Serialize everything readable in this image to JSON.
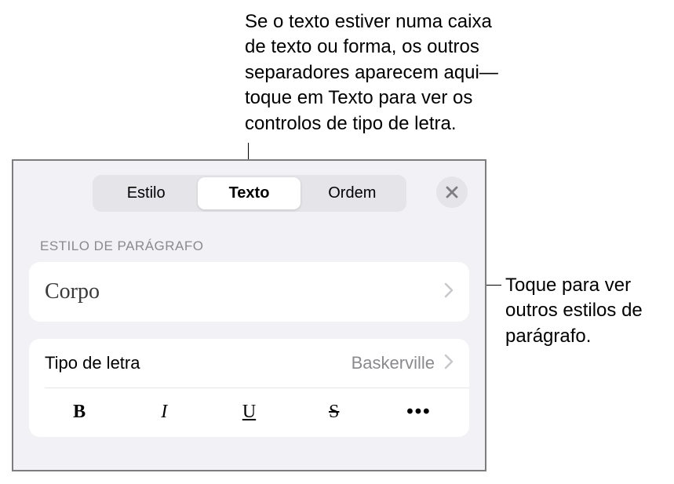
{
  "annotations": {
    "top": "Se o texto estiver numa caixa de texto ou forma, os outros separadores aparecem aqui—toque em Texto para ver os controlos de tipo de letra.",
    "right": "Toque para ver outros estilos de parágrafo."
  },
  "tabs": {
    "style": "Estilo",
    "text": "Texto",
    "order": "Ordem"
  },
  "section": {
    "paragraph_style_label": "ESTILO DE PARÁGRAFO"
  },
  "paragraph_style": {
    "name": "Corpo"
  },
  "font": {
    "label": "Tipo de letra",
    "value": "Baskerville"
  },
  "format": {
    "bold": "B",
    "italic": "I",
    "underline": "U",
    "strike": "S",
    "more": "•••"
  }
}
